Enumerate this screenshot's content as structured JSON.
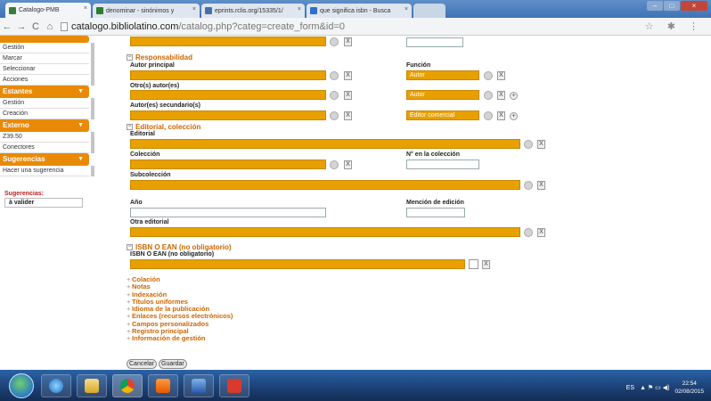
{
  "browser": {
    "tabs": [
      {
        "title": "Catalogo-PMB",
        "active": true,
        "color": "#3a7d3a"
      },
      {
        "title": "denominar - sinónimos y",
        "active": false,
        "color": "#2d7d2d"
      },
      {
        "title": "eprints.rclis.org/15335/1/",
        "active": false,
        "color": "#4a6ea8"
      },
      {
        "title": "que significa isbn - Busca",
        "active": false,
        "color": "#2f6fd0"
      }
    ],
    "url_host": "catalogo.bibliolatino.com",
    "url_path": "/catalog.php?categ=create_form&id=0"
  },
  "sidebar": {
    "top_items": [
      "Gestión",
      "Marcar",
      "Seleccionar",
      "Acciones"
    ],
    "groups": [
      {
        "title": "Estantes",
        "items": [
          "Gestión",
          "Creación"
        ]
      },
      {
        "title": "Externo",
        "items": [
          "Z39.50",
          "Conectores"
        ]
      },
      {
        "title": "Sugerencias",
        "items": [
          "Hacer una sugerencia"
        ]
      }
    ],
    "suggestions_title": "Sugerencias:",
    "suggestions_value": "à valider"
  },
  "form": {
    "responsabilidad": "Responsabilidad",
    "autor_principal": "Autor principal",
    "funcion": "Función",
    "autor_value": "Autor",
    "otros_autores": "Otro(s) autor(es)",
    "autor_value2": "Autor",
    "autores_secundarios": "Autor(es) secundario(s)",
    "editor_comercial": "Editor comercial",
    "editorial_coleccion": "Editorial, colección",
    "editorial": "Editorial",
    "coleccion": "Colección",
    "num_coleccion": "N° en la colección",
    "subcoleccion": "Subcolección",
    "anio": "Año",
    "mencion_edicion": "Mención de edición",
    "otra_editorial": "Otra editorial",
    "isbn_section": "ISBN O EAN (no obligatorio)",
    "isbn_label": "ISBN O EAN (no obligatorio)",
    "collapsed_sections": [
      "Colación",
      "Notas",
      "Indexación",
      "Títulos uniformes",
      "Idioma de la publicación",
      "Enlaces (recursos electrónicos)",
      "Campos personalizados",
      "Registro principal",
      "Información de gestión"
    ],
    "cancel_label": "Cancelar",
    "save_label": "Guardar"
  },
  "taskbar": {
    "lang": "ES",
    "time": "22:54",
    "date": "02/08/2015"
  }
}
